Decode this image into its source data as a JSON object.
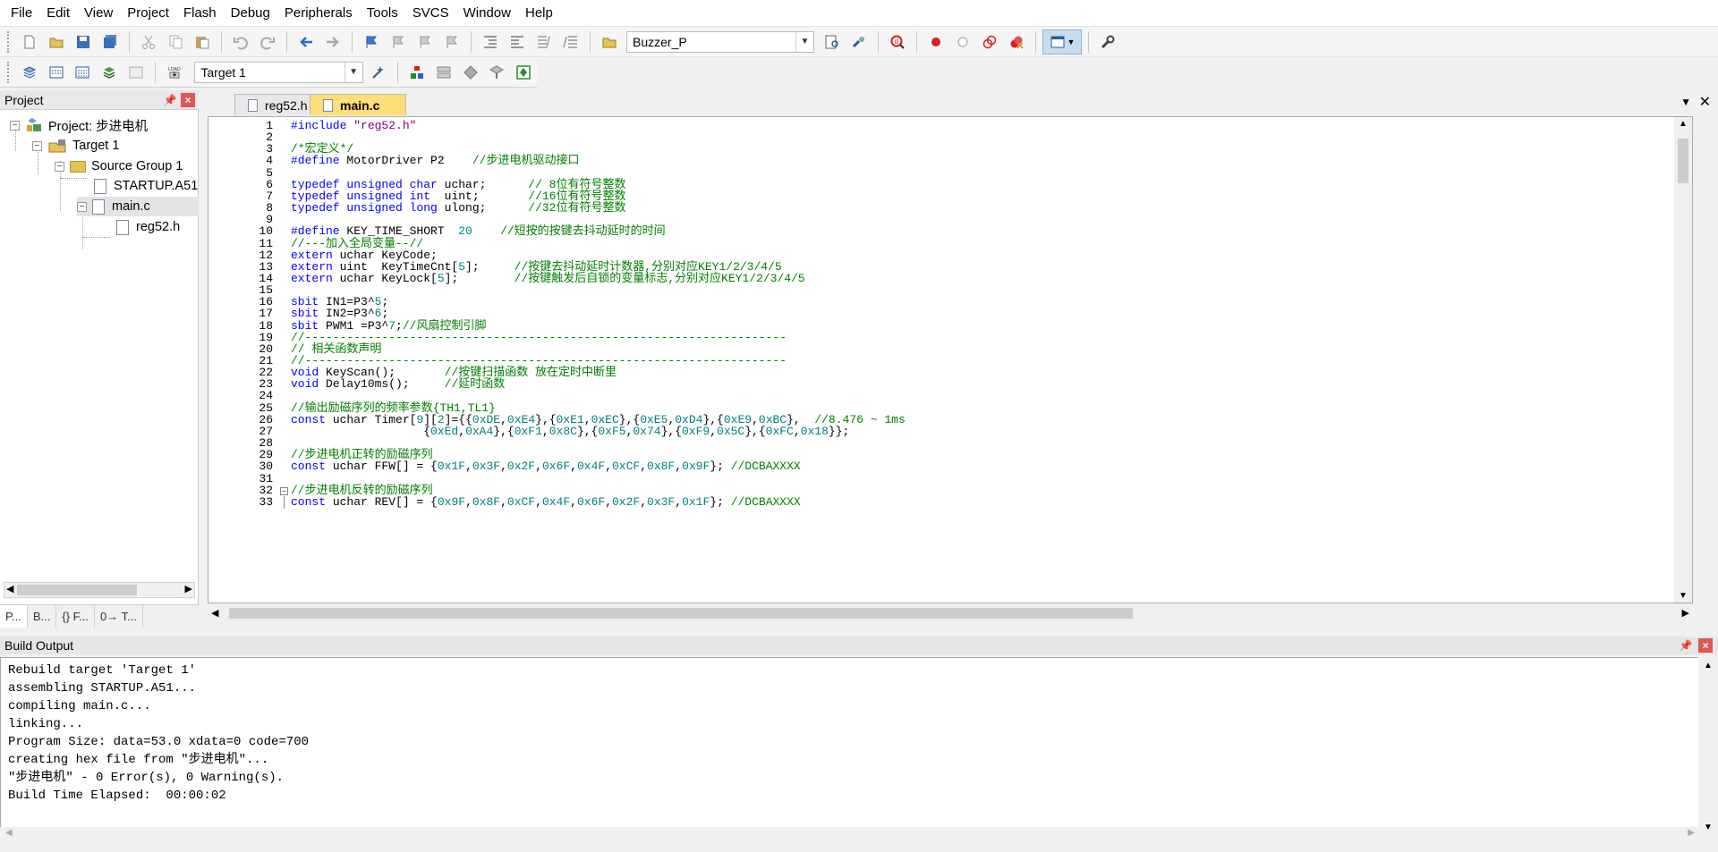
{
  "menu": [
    "File",
    "Edit",
    "View",
    "Project",
    "Flash",
    "Debug",
    "Peripherals",
    "Tools",
    "SVCS",
    "Window",
    "Help"
  ],
  "toolbar": {
    "find_combo": "Buzzer_P",
    "target_combo": "Target 1"
  },
  "project_panel": {
    "title": "Project",
    "tree": {
      "project": "Project: 步进电机",
      "target": "Target 1",
      "group": "Source Group 1",
      "files": [
        "STARTUP.A51",
        "main.c"
      ],
      "include": "reg52.h"
    },
    "tabs": [
      "P...",
      "B...",
      "{} F...",
      "0→ T..."
    ]
  },
  "editor": {
    "tabs": [
      {
        "label": "reg52.h",
        "active": false
      },
      {
        "label": "main.c",
        "active": true
      }
    ],
    "lines": [
      [
        [
          "k",
          "#include "
        ],
        [
          "s",
          "\"reg52.h\""
        ]
      ],
      [],
      [
        [
          "c",
          "/*宏定义*/"
        ]
      ],
      [
        [
          "k",
          "#define "
        ],
        [
          "p",
          "MotorDriver P2    "
        ],
        [
          "c",
          "//步进电机驱动接口"
        ]
      ],
      [],
      [
        [
          "k",
          "typedef unsigned char "
        ],
        [
          "p",
          "uchar;      "
        ],
        [
          "c",
          "// 8位有符号整数"
        ]
      ],
      [
        [
          "k",
          "typedef unsigned int  "
        ],
        [
          "p",
          "uint;       "
        ],
        [
          "c",
          "//16位有符号整数"
        ]
      ],
      [
        [
          "k",
          "typedef unsigned long "
        ],
        [
          "p",
          "ulong;      "
        ],
        [
          "c",
          "//32位有符号整数"
        ]
      ],
      [],
      [
        [
          "k",
          "#define "
        ],
        [
          "p",
          "KEY_TIME_SHORT  "
        ],
        [
          "n",
          "20"
        ],
        [
          "p",
          "    "
        ],
        [
          "c",
          "//短按的按键去抖动延时的时间"
        ]
      ],
      [
        [
          "c",
          "//---加入全局变量--//"
        ]
      ],
      [
        [
          "k",
          "extern "
        ],
        [
          "p",
          "uchar KeyCode;"
        ]
      ],
      [
        [
          "k",
          "extern "
        ],
        [
          "p",
          "uint  KeyTimeCnt["
        ],
        [
          "n",
          "5"
        ],
        [
          "p",
          "];     "
        ],
        [
          "c",
          "//按键去抖动延时计数器,分别对应KEY1/2/3/4/5"
        ]
      ],
      [
        [
          "k",
          "extern "
        ],
        [
          "p",
          "uchar KeyLock["
        ],
        [
          "n",
          "5"
        ],
        [
          "p",
          "];        "
        ],
        [
          "c",
          "//按键触发后自锁的变量标志,分别对应KEY1/2/3/4/5"
        ]
      ],
      [],
      [
        [
          "k",
          "sbit "
        ],
        [
          "p",
          "IN1=P3^"
        ],
        [
          "n",
          "5"
        ],
        [
          "p",
          ";"
        ]
      ],
      [
        [
          "k",
          "sbit "
        ],
        [
          "p",
          "IN2=P3^"
        ],
        [
          "n",
          "6"
        ],
        [
          "p",
          ";"
        ]
      ],
      [
        [
          "k",
          "sbit "
        ],
        [
          "p",
          "PWM1 =P3^"
        ],
        [
          "n",
          "7"
        ],
        [
          "p",
          ";"
        ],
        [
          "c",
          "//风扇控制引脚"
        ]
      ],
      [
        [
          "c",
          "//---------------------------------------------------------------------"
        ]
      ],
      [
        [
          "c",
          "// 相关函数声明"
        ]
      ],
      [
        [
          "c",
          "//---------------------------------------------------------------------"
        ]
      ],
      [
        [
          "k",
          "void "
        ],
        [
          "p",
          "KeyScan();       "
        ],
        [
          "c",
          "//按键扫描函数 放在定时中断里"
        ]
      ],
      [
        [
          "k",
          "void "
        ],
        [
          "p",
          "Delay10ms();     "
        ],
        [
          "c",
          "//延时函数"
        ]
      ],
      [],
      [
        [
          "c",
          "//输出励磁序列的频率参数{TH1,TL1}"
        ]
      ],
      [
        [
          "k",
          "const "
        ],
        [
          "p",
          "uchar Timer["
        ],
        [
          "n",
          "9"
        ],
        [
          "p",
          "]["
        ],
        [
          "n",
          "2"
        ],
        [
          "p",
          "]={{"
        ],
        [
          "n",
          "0xDE"
        ],
        [
          "p",
          ","
        ],
        [
          "n",
          "0xE4"
        ],
        [
          "p",
          "},{"
        ],
        [
          "n",
          "0xE1"
        ],
        [
          "p",
          ","
        ],
        [
          "n",
          "0xEC"
        ],
        [
          "p",
          "},{"
        ],
        [
          "n",
          "0xE5"
        ],
        [
          "p",
          ","
        ],
        [
          "n",
          "0xD4"
        ],
        [
          "p",
          "},{"
        ],
        [
          "n",
          "0xE9"
        ],
        [
          "p",
          ","
        ],
        [
          "n",
          "0xBC"
        ],
        [
          "p",
          "},  "
        ],
        [
          "c",
          "//8.476 ~ 1ms"
        ]
      ],
      [
        [
          "p",
          "                   {"
        ],
        [
          "n",
          "0xEd"
        ],
        [
          "p",
          ","
        ],
        [
          "n",
          "0xA4"
        ],
        [
          "p",
          "},{"
        ],
        [
          "n",
          "0xF1"
        ],
        [
          "p",
          ","
        ],
        [
          "n",
          "0x8C"
        ],
        [
          "p",
          "},{"
        ],
        [
          "n",
          "0xF5"
        ],
        [
          "p",
          ","
        ],
        [
          "n",
          "0x74"
        ],
        [
          "p",
          "},{"
        ],
        [
          "n",
          "0xF9"
        ],
        [
          "p",
          ","
        ],
        [
          "n",
          "0x5C"
        ],
        [
          "p",
          "},{"
        ],
        [
          "n",
          "0xFC"
        ],
        [
          "p",
          ","
        ],
        [
          "n",
          "0x18"
        ],
        [
          "p",
          "}};"
        ]
      ],
      [],
      [
        [
          "c",
          "//步进电机正转的励磁序列"
        ]
      ],
      [
        [
          "k",
          "const "
        ],
        [
          "p",
          "uchar FFW[] = {"
        ],
        [
          "n",
          "0x1F"
        ],
        [
          "p",
          ","
        ],
        [
          "n",
          "0x3F"
        ],
        [
          "p",
          ","
        ],
        [
          "n",
          "0x2F"
        ],
        [
          "p",
          ","
        ],
        [
          "n",
          "0x6F"
        ],
        [
          "p",
          ","
        ],
        [
          "n",
          "0x4F"
        ],
        [
          "p",
          ","
        ],
        [
          "n",
          "0xCF"
        ],
        [
          "p",
          ","
        ],
        [
          "n",
          "0x8F"
        ],
        [
          "p",
          ","
        ],
        [
          "n",
          "0x9F"
        ],
        [
          "p",
          "}; "
        ],
        [
          "c",
          "//DCBAXXXX"
        ]
      ],
      [],
      [
        [
          "c",
          "//步进电机反转的励磁序列"
        ]
      ],
      [
        [
          "k",
          "const "
        ],
        [
          "p",
          "uchar REV[] = {"
        ],
        [
          "n",
          "0x9F"
        ],
        [
          "p",
          ","
        ],
        [
          "n",
          "0x8F"
        ],
        [
          "p",
          ","
        ],
        [
          "n",
          "0xCF"
        ],
        [
          "p",
          ","
        ],
        [
          "n",
          "0x4F"
        ],
        [
          "p",
          ","
        ],
        [
          "n",
          "0x6F"
        ],
        [
          "p",
          ","
        ],
        [
          "n",
          "0x2F"
        ],
        [
          "p",
          ","
        ],
        [
          "n",
          "0x3F"
        ],
        [
          "p",
          ","
        ],
        [
          "n",
          "0x1F"
        ],
        [
          "p",
          "}; "
        ],
        [
          "c",
          "//DCBAXXXX"
        ]
      ]
    ]
  },
  "build_output": {
    "title": "Build Output",
    "lines": [
      "Rebuild target 'Target 1'",
      "assembling STARTUP.A51...",
      "compiling main.c...",
      "linking...",
      "Program Size: data=53.0 xdata=0 code=700",
      "creating hex file from \"步进电机\"...",
      "\"步进电机\" - 0 Error(s), 0 Warning(s).",
      "Build Time Elapsed:  00:00:02"
    ]
  },
  "colors": {
    "keyword": "#0000ff",
    "comment": "#008000",
    "string": "#800080",
    "number": "#008080",
    "active_tab": "#ffdd77"
  }
}
